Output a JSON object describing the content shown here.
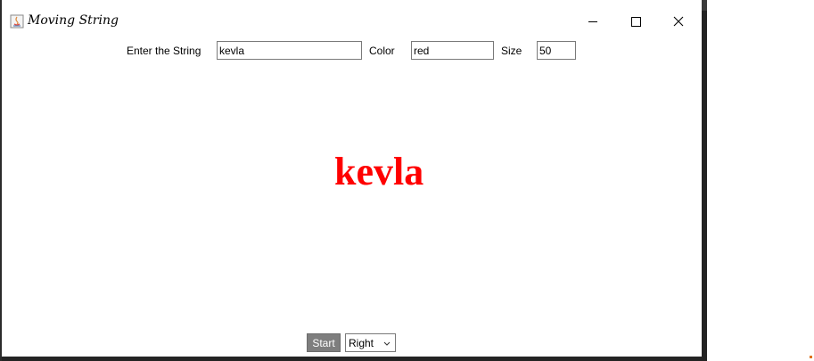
{
  "window": {
    "title": "Moving String",
    "controls": {
      "minimize_icon": "minimize-icon",
      "maximize_icon": "maximize-icon",
      "close_icon": "close-icon"
    }
  },
  "form": {
    "string_label": "Enter the String",
    "string_value": "kevla",
    "color_label": "Color",
    "color_value": "red",
    "size_label": "Size",
    "size_value": "50"
  },
  "canvas": {
    "text": "kevla",
    "color": "#ff0000"
  },
  "bottom": {
    "start_label": "Start",
    "direction_selected": "Right"
  },
  "colors": {
    "start_button_bg": "#7e7e7e",
    "border_dark": "#232323"
  }
}
